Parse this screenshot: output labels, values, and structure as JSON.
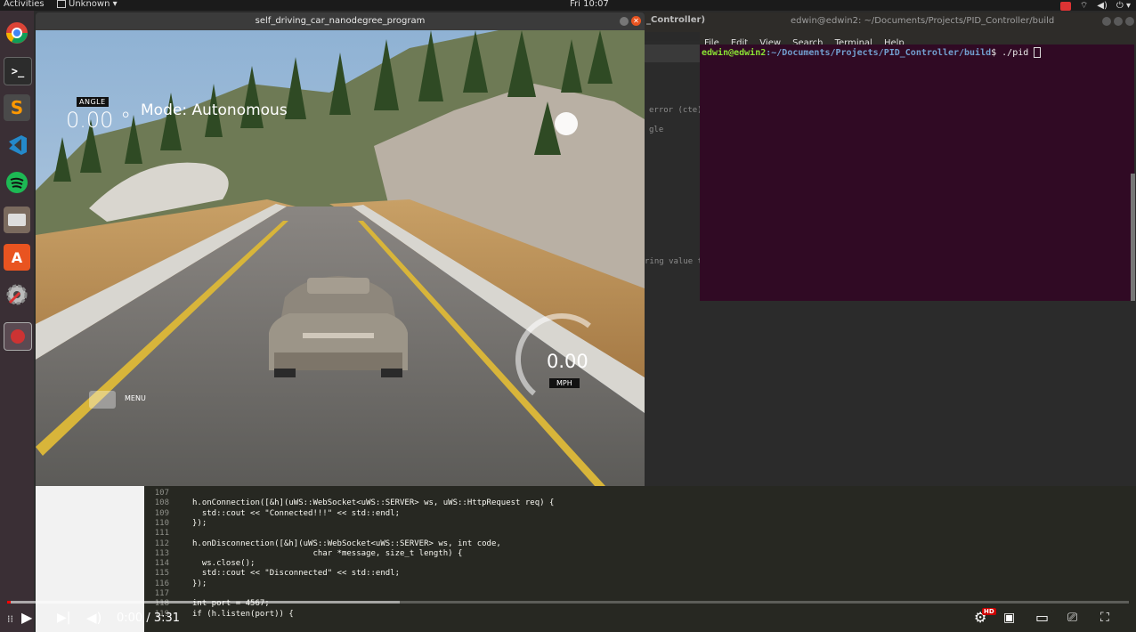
{
  "topbar": {
    "activities": "Activities",
    "app_menu": "Unknown",
    "clock": "Fri 10:07"
  },
  "launcher": {
    "apps": [
      {
        "name": "Chrome",
        "icon": "chrome-icon"
      },
      {
        "name": "Terminal",
        "icon": "terminal-icon"
      },
      {
        "name": "Sublime Text",
        "icon": "sublime-icon"
      },
      {
        "name": "VS Code",
        "icon": "vscode-icon"
      },
      {
        "name": "Spotify",
        "icon": "spotify-icon"
      },
      {
        "name": "Files",
        "icon": "files-icon"
      },
      {
        "name": "Software",
        "icon": "software-icon"
      },
      {
        "name": "Settings",
        "icon": "settings-icon"
      },
      {
        "name": "Simulator",
        "icon": "simulator-icon"
      }
    ]
  },
  "simulator": {
    "title": "self_driving_car_nanodegree_program",
    "angle_label": "ANGLE",
    "angle_value": "0.00 °",
    "mode": "Mode: Autonomous",
    "speed_value": "0.00",
    "speed_unit": "MPH",
    "menu_label": "MENU"
  },
  "terminal": {
    "tab_fragment": "_Controller)",
    "title": "edwin@edwin2: ~/Documents/Projects/PID_Controller/build",
    "menu": [
      "File",
      "Edit",
      "View",
      "Search",
      "Terminal",
      "Help"
    ],
    "prompt_user": "edwin@edwin2",
    "prompt_path": ":~/Documents/Projects/PID_Controller/build",
    "prompt_cmd": "$ ./pid "
  },
  "editor": {
    "hints": [
      " error (cte)",
      "gle",
      "ring value t"
    ],
    "lines": [
      {
        "n": "107",
        "code": ""
      },
      {
        "n": "108",
        "code": "h.onConnection([&h](uWS::WebSocket<uWS::SERVER> ws, uWS::HttpRequest req) {"
      },
      {
        "n": "109",
        "code": "  std::cout << \"Connected!!!\" << std::endl;"
      },
      {
        "n": "110",
        "code": "});"
      },
      {
        "n": "111",
        "code": ""
      },
      {
        "n": "112",
        "code": "h.onDisconnection([&h](uWS::WebSocket<uWS::SERVER> ws, int code,"
      },
      {
        "n": "113",
        "code": "                         char *message, size_t length) {"
      },
      {
        "n": "114",
        "code": "  ws.close();"
      },
      {
        "n": "115",
        "code": "  std::cout << \"Disconnected\" << std::endl;"
      },
      {
        "n": "116",
        "code": "});"
      },
      {
        "n": "117",
        "code": ""
      },
      {
        "n": "118",
        "code": "int port = 4567;"
      },
      {
        "n": "119",
        "code": "if (h.listen(port)) {"
      }
    ]
  },
  "video": {
    "time": "0:00 / 3:31",
    "buffered_fraction": 0.35,
    "played_fraction": 0.0,
    "hd": "HD"
  }
}
